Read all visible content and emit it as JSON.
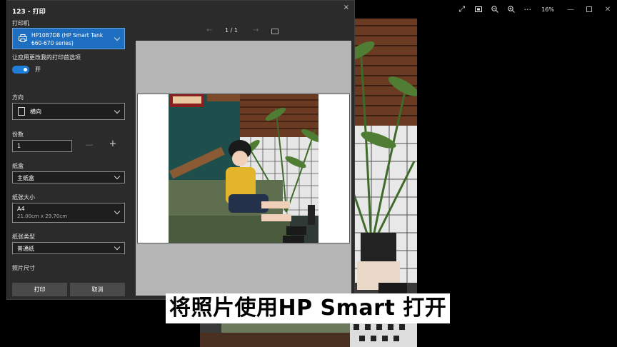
{
  "viewer": {
    "zoom_label": "16%",
    "icons": [
      "expand-icon",
      "crop-icon",
      "zoom-out-icon",
      "zoom-in-icon",
      "more-icon"
    ],
    "more_glyph": "···"
  },
  "dialog": {
    "title": "123 - 打印",
    "close_glyph": "×"
  },
  "printer": {
    "label": "打印机",
    "value": "HP10B7D8 (HP Smart Tank 660-670 series)"
  },
  "app_prefs": {
    "label": "让应用更改我的打印首选项",
    "toggle_label": "开",
    "toggle_on": true
  },
  "orientation": {
    "label": "方向",
    "value": "横向"
  },
  "copies": {
    "label": "份数",
    "value": "1",
    "minus_glyph": "—",
    "plus_glyph": "+"
  },
  "paper_tray": {
    "label": "纸盒",
    "value": "主纸盒"
  },
  "paper_size": {
    "label": "纸张大小",
    "value": "A4",
    "dimensions": "21.00cm x 29.70cm"
  },
  "paper_type": {
    "label": "纸张类型",
    "value": "普通纸"
  },
  "photo_size": {
    "label": "照片尺寸"
  },
  "buttons": {
    "print": "打印",
    "cancel": "取消"
  },
  "preview": {
    "page_indicator": "1 / 1",
    "prev_glyph": "←",
    "next_glyph": "→"
  },
  "subtitle": "将照片使用HP Smart 打开",
  "colors": {
    "accent": "#1e6fc2",
    "dialog_bg": "#2b2b2b",
    "preview_bg": "#b5b5b5"
  }
}
